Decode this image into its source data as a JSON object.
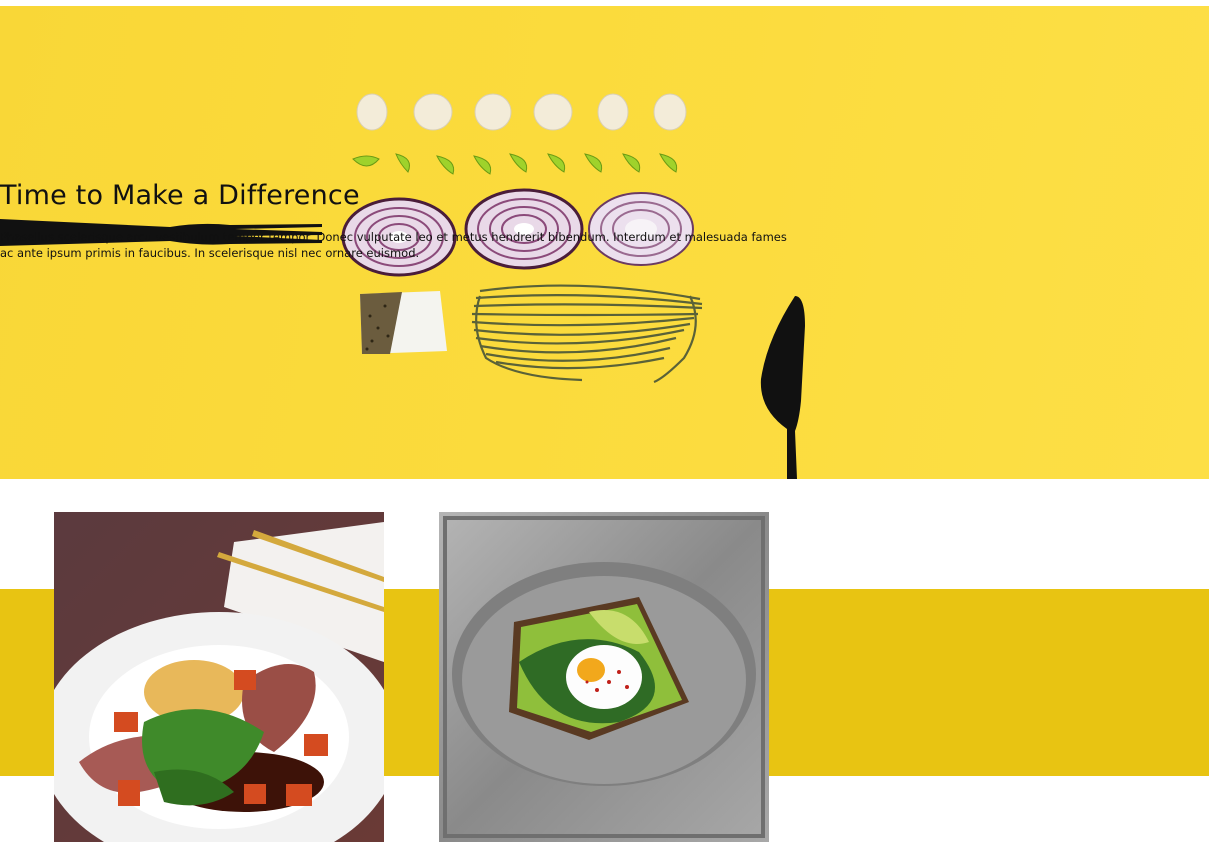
{
  "hero": {
    "title": "Time to Make a Difference",
    "text": "Phasellus scelerisque arcu vestibulum tempor tempor. Donec vulputate leo et metus hendrerit bibendum. Interdum et malesuada fames ac ante ipsum primis in faucibus. In scelerisque nisl nec ornare euismod."
  },
  "colors": {
    "hero_background": "#fbdb3c",
    "band": "#e8c412",
    "text": "#111111"
  },
  "gallery": {
    "images": [
      {
        "name": "steak-dish-photo"
      },
      {
        "name": "egg-avocado-toast-photo"
      }
    ]
  }
}
